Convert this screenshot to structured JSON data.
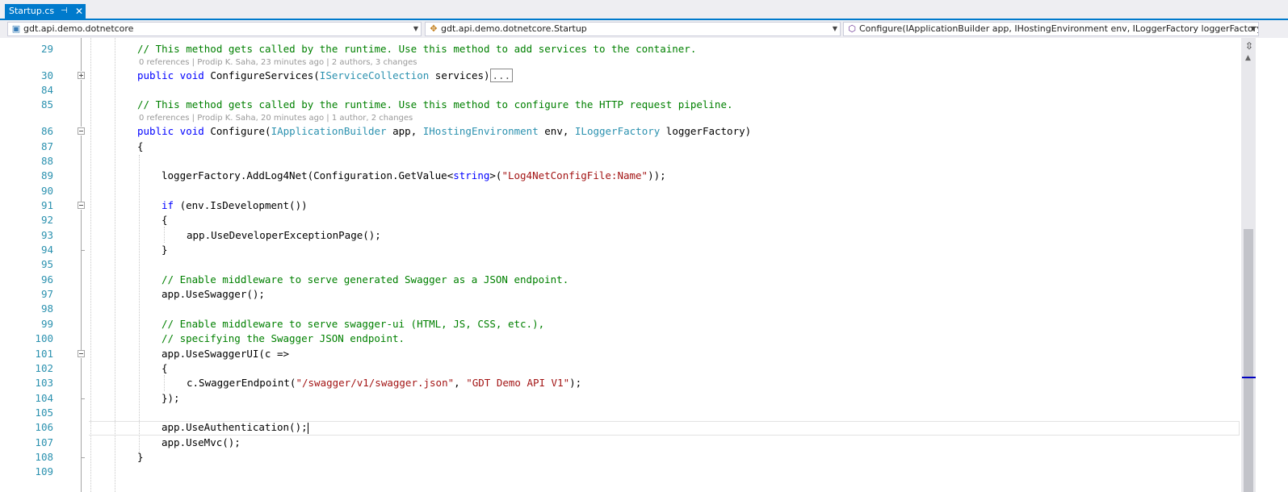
{
  "tab": {
    "label": "Startup.cs",
    "pin_glyph": "⊣",
    "close_glyph": "✕"
  },
  "navbar": {
    "project": "gdt.api.demo.dotnetcore",
    "type": "gdt.api.demo.dotnetcore.Startup",
    "member": "Configure(IApplicationBuilder app, IHostingEnvironment env, ILoggerFactory loggerFactory)"
  },
  "lines": {
    "l29": "29",
    "l30": "30",
    "l84": "84",
    "l85": "85",
    "l86": "86",
    "l87": "87",
    "l88": "88",
    "l89": "89",
    "l90": "90",
    "l91": "91",
    "l92": "92",
    "l93": "93",
    "l94": "94",
    "l95": "95",
    "l96": "96",
    "l97": "97",
    "l98": "98",
    "l99": "99",
    "l100": "100",
    "l101": "101",
    "l102": "102",
    "l103": "103",
    "l104": "104",
    "l105": "105",
    "l106": "106",
    "l107": "107",
    "l108": "108",
    "l109": "109"
  },
  "codelens": {
    "configure_services": "0 references | Prodip K. Saha, 23 minutes ago | 2 authors, 3 changes",
    "configure": "0 references | Prodip K. Saha, 20 minutes ago | 1 author, 2 changes"
  },
  "code": {
    "c29": "// This method gets called by the runtime. Use this method to add services to the container.",
    "c30_kw": "public void",
    "c30_name": " ConfigureServices(",
    "c30_type": "IServiceCollection",
    "c30_rest": " services)",
    "c30_collapsed": "...",
    "c85": "// This method gets called by the runtime. Use this method to configure the HTTP request pipeline.",
    "c86_kw": "public void",
    "c86_name": " Configure(",
    "c86_t1": "IApplicationBuilder",
    "c86_p1": " app, ",
    "c86_t2": "IHostingEnvironment",
    "c86_p2": " env, ",
    "c86_t3": "ILoggerFactory",
    "c86_p3": " loggerFactory)",
    "c87": "{",
    "c89_a": "loggerFactory.AddLog4Net(Configuration.GetValue<",
    "c89_kw": "string",
    "c89_b": ">(",
    "c89_str": "\"Log4NetConfigFile:Name\"",
    "c89_c": "));",
    "c91_kw": "if",
    "c91_rest": " (env.IsDevelopment())",
    "c92": "{",
    "c93": "app.UseDeveloperExceptionPage();",
    "c94": "}",
    "c96": "// Enable middleware to serve generated Swagger as a JSON endpoint.",
    "c97": "app.UseSwagger();",
    "c99": "// Enable middleware to serve swagger-ui (HTML, JS, CSS, etc.),",
    "c100": "// specifying the Swagger JSON endpoint.",
    "c101": "app.UseSwaggerUI(c =>",
    "c102": "{",
    "c103_a": "c.SwaggerEndpoint(",
    "c103_s1": "\"/swagger/v1/swagger.json\"",
    "c103_b": ", ",
    "c103_s2": "\"GDT Demo API V1\"",
    "c103_c": ");",
    "c104": "});",
    "c106": "app.UseAuthentication();",
    "c107": "app.UseMvc();",
    "c108": "}"
  },
  "colors": {
    "accent": "#007acc",
    "keyword": "#0000ff",
    "type": "#2b91af",
    "comment": "#008000",
    "string": "#a31515"
  }
}
